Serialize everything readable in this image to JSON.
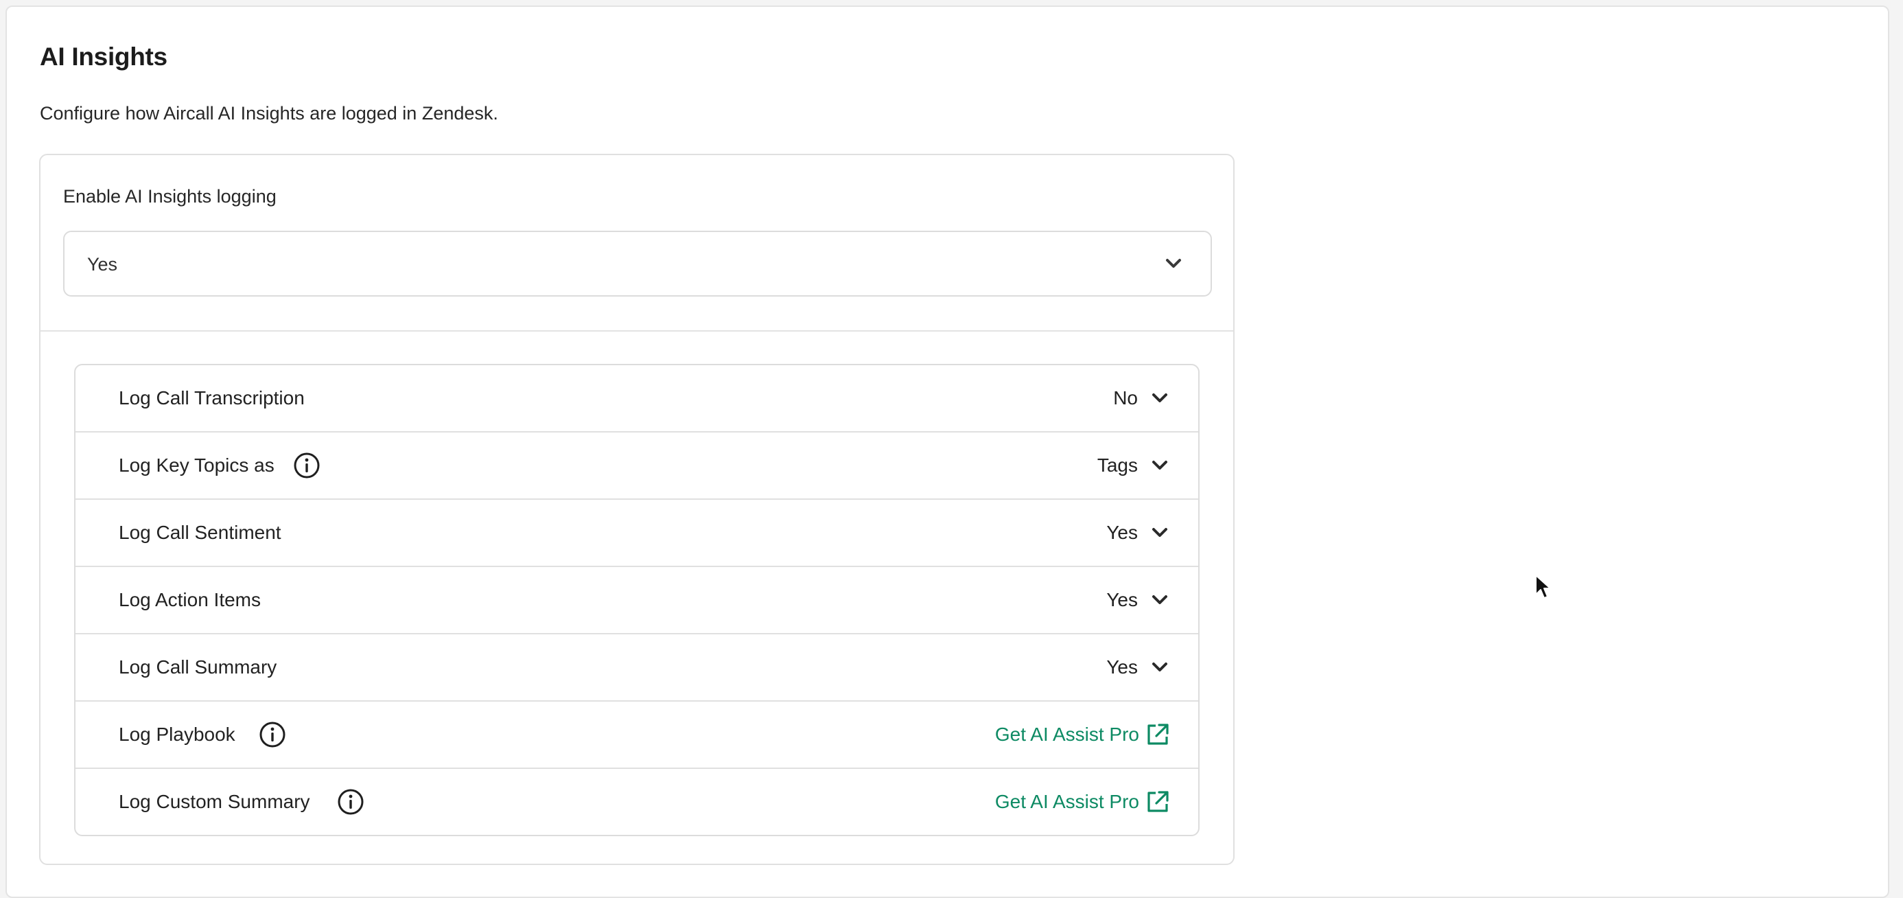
{
  "section": {
    "title": "AI Insights",
    "description": "Configure how Aircall AI Insights are logged in Zendesk."
  },
  "enable": {
    "label": "Enable AI Insights logging",
    "value": "Yes"
  },
  "rows": [
    {
      "label": "Log Call Transcription",
      "value": "No",
      "info": false,
      "type": "select"
    },
    {
      "label": "Log Key Topics as",
      "value": "Tags",
      "info": true,
      "type": "select"
    },
    {
      "label": "Log Call Sentiment",
      "value": "Yes",
      "info": false,
      "type": "select"
    },
    {
      "label": "Log Action Items",
      "value": "Yes",
      "info": false,
      "type": "select"
    },
    {
      "label": "Log Call Summary",
      "value": "Yes",
      "info": false,
      "type": "select"
    },
    {
      "label": "Log Playbook",
      "value": "Get AI Assist Pro",
      "info": true,
      "type": "link"
    },
    {
      "label": "Log Custom Summary",
      "value": "Get AI Assist Pro",
      "info": true,
      "type": "link"
    }
  ],
  "colors": {
    "accent_link": "#0d8a63",
    "border": "#e0e0e0"
  },
  "icons": {
    "chevron": "chevron-down-icon",
    "info": "info-icon",
    "external": "external-link-icon"
  }
}
